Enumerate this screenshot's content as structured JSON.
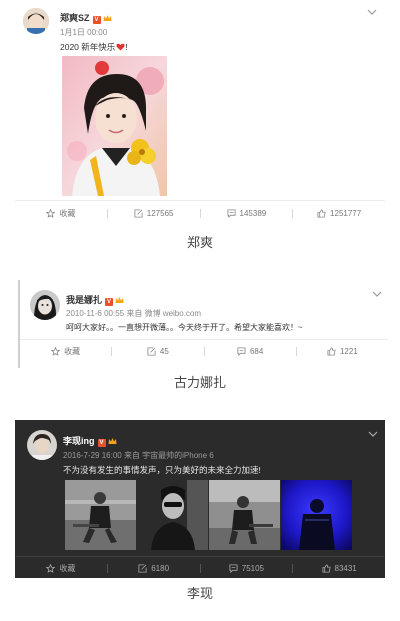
{
  "posts": [
    {
      "username": "郑爽SZ",
      "meta": "1月1日 00:00",
      "text": "2020 新年快乐",
      "text_suffix": "!",
      "actions": {
        "favorite": "收藏",
        "repost": "127565",
        "comment": "145389",
        "like": "1251777"
      },
      "caption": "郑爽"
    },
    {
      "username": "我是娜扎",
      "meta": "2010-11-6 00:55 来自 微博 weibo.com",
      "text": "呵呵大家好。。一直想开微薄。。今天终于开了。希望大家能喜欢！~",
      "actions": {
        "favorite": "收藏",
        "repost": "45",
        "comment": "684",
        "like": "1221"
      },
      "caption": "古力娜扎"
    },
    {
      "username": "李现ing",
      "meta": "2016-7-29 16:00 来自 宇宙最帅的iPhone 6",
      "text": "不为没有发生的事情发声，只为美好的未来全力加速!",
      "actions": {
        "favorite": "收藏",
        "repost": "6180",
        "comment": "75105",
        "like": "83431"
      },
      "caption": "李现"
    }
  ],
  "badge_letter": "V",
  "colors": {
    "badge": "#e9512c",
    "crown": "#f2a516",
    "heart": "#e0342c",
    "dark_card": "#2b2b2b"
  },
  "icons": [
    "star-icon",
    "repost-icon",
    "comment-icon",
    "like-icon",
    "chevron-down-icon",
    "crown-icon",
    "heart-icon"
  ]
}
